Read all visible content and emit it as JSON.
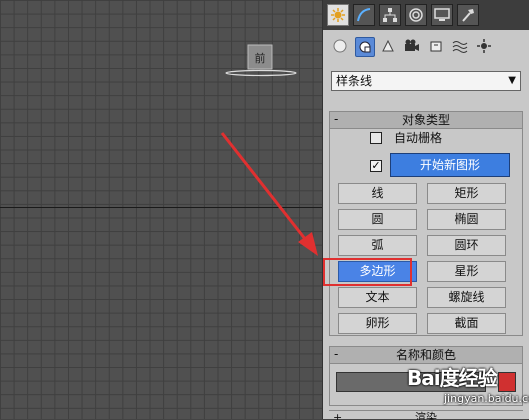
{
  "viewport": {
    "viewcube_label": "前"
  },
  "panel": {
    "tabs": [
      {
        "icon": "create-icon",
        "active": true
      },
      {
        "icon": "modify-icon",
        "active": false
      },
      {
        "icon": "hierarchy-icon",
        "active": false
      },
      {
        "icon": "motion-icon",
        "active": false
      },
      {
        "icon": "display-icon",
        "active": false
      },
      {
        "icon": "utilities-icon",
        "active": false
      }
    ],
    "subcategories": [
      {
        "icon": "geometry-icon",
        "active": false
      },
      {
        "icon": "shapes-icon",
        "active": true
      },
      {
        "icon": "lights-icon",
        "active": false
      },
      {
        "icon": "cameras-icon",
        "active": false
      },
      {
        "icon": "helpers-icon",
        "active": false
      },
      {
        "icon": "spacewarps-icon",
        "active": false
      },
      {
        "icon": "systems-icon",
        "active": false
      }
    ],
    "category_value": "样条线",
    "object_type": {
      "title": "对象类型",
      "collapse": "-",
      "autogrid_label": "自动栅格",
      "start_new_checked": "✓",
      "start_new_label": "开始新图形",
      "buttons": [
        "线",
        "矩形",
        "圆",
        "椭圆",
        "弧",
        "圆环",
        "多边形",
        "星形",
        "文本",
        "螺旋线",
        "卵形",
        "截面"
      ],
      "selected": "多边形"
    },
    "name_color": {
      "title": "名称和颜色",
      "collapse": "-",
      "swatch_color": "#d03030"
    },
    "next_rollout": {
      "title": "渲染",
      "collapse": "+"
    }
  },
  "watermark": {
    "logo": "Bai度经验",
    "url": "jingyan.baidu.com"
  },
  "colors": {
    "accent": "#4a83e6",
    "arrow": "#e03030"
  }
}
